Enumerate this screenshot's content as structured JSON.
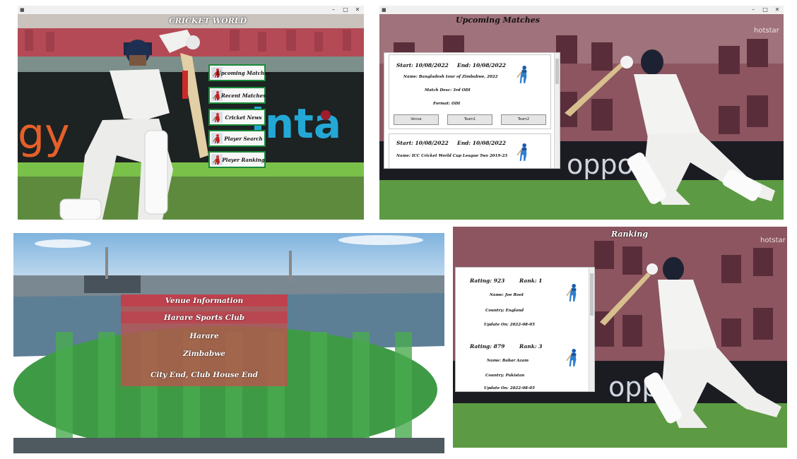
{
  "window_controls": {
    "minimize": "–",
    "maximize": "□",
    "close": "✕"
  },
  "home": {
    "title": "CRICKET WORLD",
    "menu": [
      {
        "label": "Upcoming Matches",
        "icon": "batsman-thumbnail-icon"
      },
      {
        "label": "Recent Matches",
        "icon": "batsman-thumbnail-icon"
      },
      {
        "label": "Cricket News",
        "icon": "batsman-thumbnail-icon"
      },
      {
        "label": "Player Search",
        "icon": "batsman-thumbnail-icon"
      },
      {
        "label": "Player Ranking",
        "icon": "batsman-thumbnail-icon"
      }
    ],
    "background_text": {
      "left": "gy",
      "right": "inta"
    }
  },
  "upcoming": {
    "title": "Upcoming Matches",
    "watermark": "hotstar",
    "sponsor": "oppo",
    "matches": [
      {
        "start": "Start: 10/08/2022",
        "end": "End: 10/08/2022",
        "name": "Name: Bangladesh tour of Zimbabwe, 2022",
        "desc": "Match Desc: 3rd ODI",
        "format": "Format: ODI",
        "buttons": [
          "Venue",
          "Team1",
          "Team2"
        ]
      },
      {
        "start": "Start: 10/08/2022",
        "end": "End: 10/08/2022",
        "name": "Name: ICC Cricket World Cup League Two 2019-23"
      }
    ]
  },
  "venue": {
    "title": "Venue Information",
    "rows": [
      "Harare Sports Club",
      "Harare",
      "Zimbabwe",
      "City End, Club House End"
    ]
  },
  "ranking": {
    "title": "Ranking",
    "watermark": "hotstar",
    "sponsor": "oppo",
    "players": [
      {
        "rating": "Rating: 923",
        "rank": "Rank: 1",
        "name": "Name: Joe Root",
        "country": "Country: England",
        "update": "Update On: 2022-08-05"
      },
      {
        "rating": "Rating: 879",
        "rank": "Rank: 3",
        "name": "Name: Babar Azam",
        "country": "Country: Pakistan",
        "update": "Update On: 2022-08-05"
      }
    ]
  },
  "colors": {
    "menu_border": "#1a8a3a",
    "title_bar": "#f0f0f0",
    "venue_overlay": "#c0504d"
  }
}
